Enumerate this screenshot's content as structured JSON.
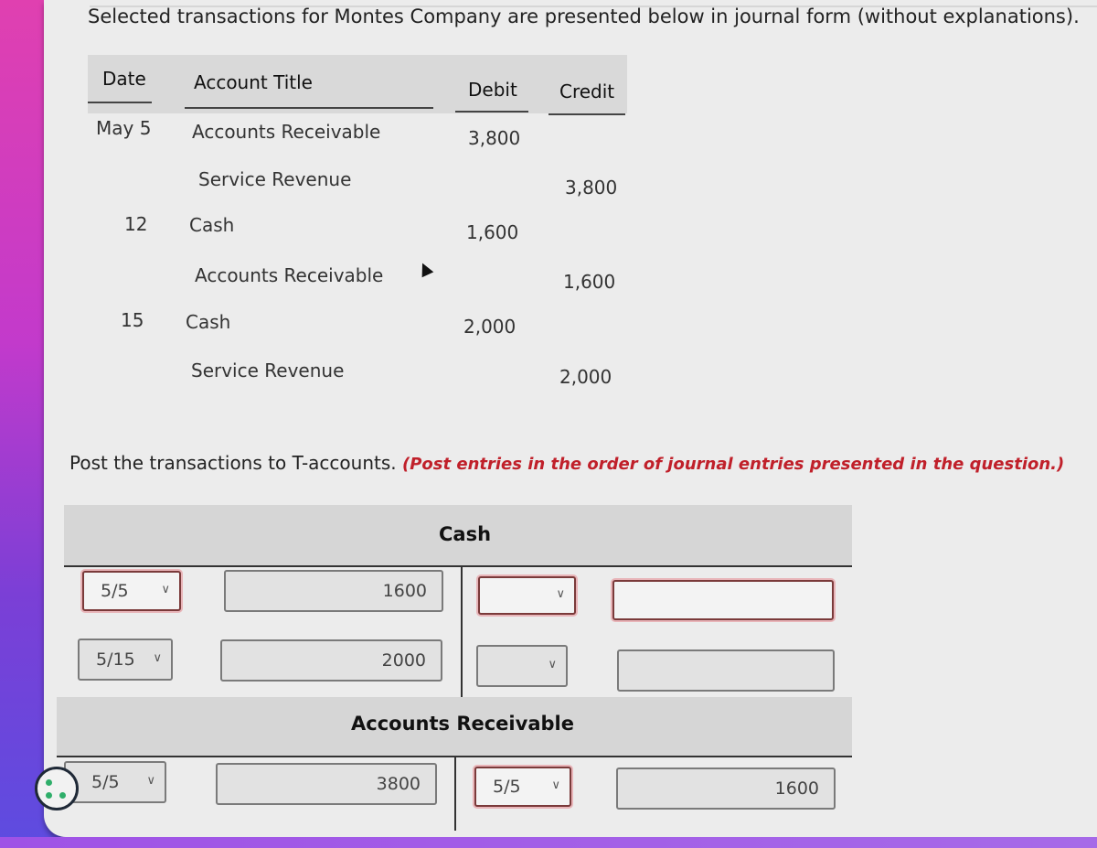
{
  "intro_text": "Selected transactions for Montes Company are presented below in journal form (without explanations).",
  "journal": {
    "headers": {
      "date": "Date",
      "account": "Account Title",
      "debit": "Debit",
      "credit": "Credit"
    },
    "rows": [
      {
        "date": "May 5",
        "account": "Accounts Receivable",
        "debit": "3,800",
        "credit": ""
      },
      {
        "date": "",
        "account": "Service Revenue",
        "debit": "",
        "credit": "3,800"
      },
      {
        "date": "12",
        "account": "Cash",
        "debit": "1,600",
        "credit": ""
      },
      {
        "date": "",
        "account": "Accounts Receivable",
        "debit": "",
        "credit": "1,600"
      },
      {
        "date": "15",
        "account": "Cash",
        "debit": "2,000",
        "credit": ""
      },
      {
        "date": "",
        "account": "Service Revenue",
        "debit": "",
        "credit": "2,000"
      }
    ]
  },
  "instructions": {
    "main": "Post the transactions to T-accounts. ",
    "note": "(Post entries in the order of journal entries presented in the question.)"
  },
  "t_accounts": [
    {
      "title": "Cash",
      "debit_rows": [
        {
          "date": "5/5",
          "amount": "1600",
          "date_error": true
        },
        {
          "date": "5/15",
          "amount": "2000",
          "date_error": false
        }
      ],
      "credit_rows": [
        {
          "date": "",
          "amount": "",
          "date_error": true,
          "amount_error": true
        },
        {
          "date": "",
          "amount": "",
          "date_error": false,
          "amount_error": false
        }
      ]
    },
    {
      "title": "Accounts Receivable",
      "debit_rows": [
        {
          "date": "5/5",
          "amount": "3800",
          "date_error": false
        }
      ],
      "credit_rows": [
        {
          "date": "5/5",
          "amount": "1600",
          "date_error": true,
          "amount_error": false
        }
      ]
    }
  ],
  "colors": {
    "error_border": "#7a3a3a",
    "note_red": "#c0202a",
    "cookie_dots": "#2fae6a"
  }
}
